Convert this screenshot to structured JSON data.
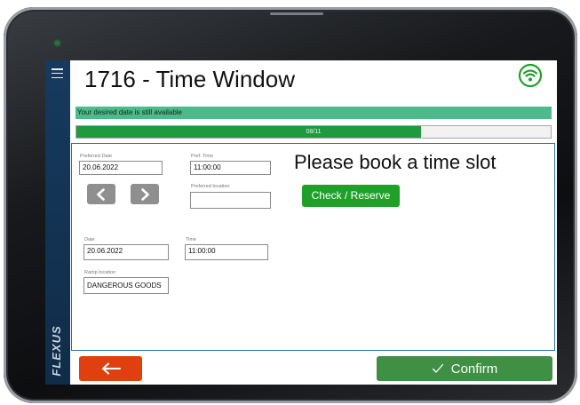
{
  "app": {
    "brand": "FLEXUS",
    "title": "1716 - Time Window",
    "icons": {
      "menu": "menu-icon",
      "wifi": "wifi-icon"
    },
    "colors": {
      "sidebar": "#163a5e",
      "accent_green": "#1fa028",
      "banner": "#4cba8b",
      "back": "#e0400f",
      "confirm": "#3f8f45",
      "frame": "#2f6fb0"
    }
  },
  "banner": {
    "message": "Your desired date is still available"
  },
  "progress": {
    "text": "08/11",
    "current": 8,
    "total": 11
  },
  "form": {
    "preferred_date": {
      "label": "Preferred Date",
      "value": "20.06.2022"
    },
    "pref_time": {
      "label": "Pref. Time",
      "value": "11:00:00"
    },
    "preferred_location": {
      "label": "Preferred location",
      "value": ""
    },
    "prev_icon": "chevron-left-icon",
    "next_icon": "chevron-right-icon",
    "headline": "Please book a time slot",
    "check_reserve_label": "Check / Reserve",
    "date": {
      "label": "Date",
      "value": "20.06.2022"
    },
    "time": {
      "label": "Time",
      "value": "11:00:00"
    },
    "ramp_location": {
      "label": "Ramp location",
      "value": "DANGEROUS GOODS"
    }
  },
  "footer": {
    "back_icon": "arrow-left-icon",
    "confirm_icon": "checkmark-icon",
    "confirm_label": "Confirm"
  }
}
